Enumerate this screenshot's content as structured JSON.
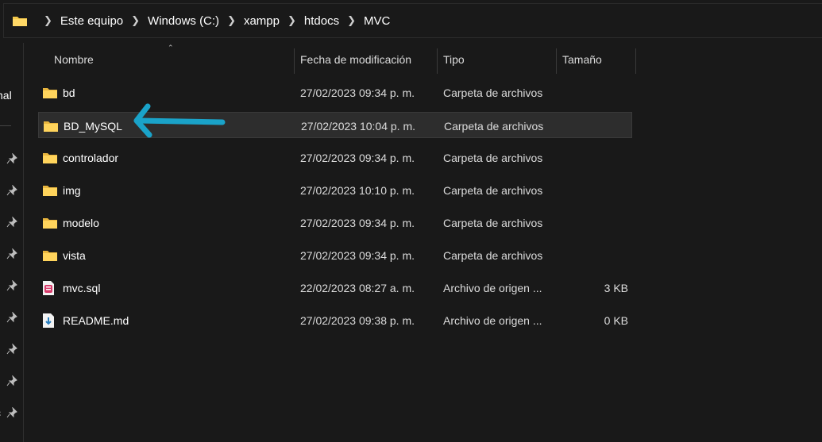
{
  "breadcrumb": {
    "items": [
      "Este equipo",
      "Windows (C:)",
      "xampp",
      "htdocs",
      "MVC"
    ],
    "icon": "folder-icon"
  },
  "sidebar": {
    "partial_label": "nal",
    "partial_label_bottom": "c",
    "pin_icon": "pin-icon"
  },
  "columns": {
    "name": "Nombre",
    "date": "Fecha de modificación",
    "type": "Tipo",
    "size": "Tamaño"
  },
  "files": [
    {
      "name": "bd",
      "date": "27/02/2023 09:34 p. m.",
      "type": "Carpeta de archivos",
      "size": "",
      "icon": "folder-icon"
    },
    {
      "name": "BD_MySQL",
      "date": "27/02/2023 10:04 p. m.",
      "type": "Carpeta de archivos",
      "size": "",
      "icon": "folder-icon"
    },
    {
      "name": "controlador",
      "date": "27/02/2023 09:34 p. m.",
      "type": "Carpeta de archivos",
      "size": "",
      "icon": "folder-icon"
    },
    {
      "name": "img",
      "date": "27/02/2023 10:10 p. m.",
      "type": "Carpeta de archivos",
      "size": "",
      "icon": "folder-icon"
    },
    {
      "name": "modelo",
      "date": "27/02/2023 09:34 p. m.",
      "type": "Carpeta de archivos",
      "size": "",
      "icon": "folder-icon"
    },
    {
      "name": "vista",
      "date": "27/02/2023 09:34 p. m.",
      "type": "Carpeta de archivos",
      "size": "",
      "icon": "folder-icon"
    },
    {
      "name": "mvc.sql",
      "date": "22/02/2023 08:27 a. m.",
      "type": "Archivo de origen ...",
      "size": "3 KB",
      "icon": "sql-file-icon"
    },
    {
      "name": "README.md",
      "date": "27/02/2023 09:38 p. m.",
      "type": "Archivo de origen ...",
      "size": "0 KB",
      "icon": "markdown-file-icon"
    }
  ],
  "annotation": {
    "arrow_color": "#1aa3c9",
    "icon": "arrow-left-icon"
  },
  "colors": {
    "folder": "#f4c84a",
    "background": "#191919",
    "selected": "#2d2d2d"
  }
}
